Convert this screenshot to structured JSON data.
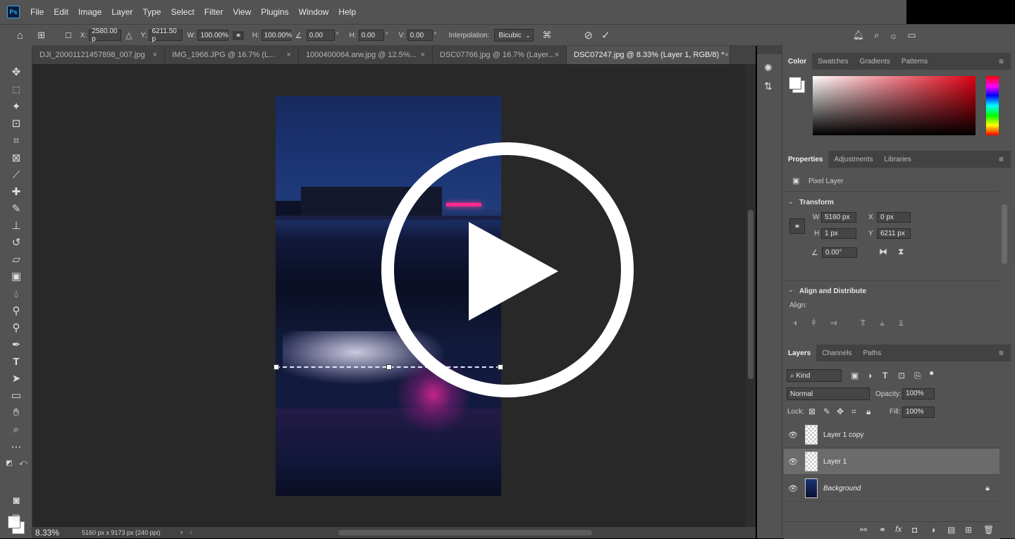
{
  "app": {
    "logo_text": "Ps"
  },
  "menu": [
    "File",
    "Edit",
    "Image",
    "Layer",
    "Type",
    "Select",
    "Filter",
    "View",
    "Plugins",
    "Window",
    "Help"
  ],
  "options": {
    "x_label": "X:",
    "x_value": "2580.00 p",
    "y_label": "Y:",
    "y_value": "6211.50 p",
    "w_label": "W:",
    "w_value": "100.00%",
    "h_label": "H:",
    "h_value": "100.00%",
    "angle_value": "0.00",
    "deg": "°",
    "hskew_label": "H:",
    "hskew_value": "0.00",
    "vskew_label": "V:",
    "vskew_value": "0.00",
    "interp_label": "Interpolation:",
    "interp_value": "Bicubic"
  },
  "tabs": [
    {
      "label": "DJI_20001121457898_007.jpg",
      "close": "×"
    },
    {
      "label": "IMG_1968.JPG @ 16.7% (L...",
      "close": "×"
    },
    {
      "label": "1000400064.arw.jpg @ 12.5%...",
      "close": "×"
    },
    {
      "label": "DSC07766.jpg @ 16.7% (Layer...",
      "close": "×"
    },
    {
      "label": "DSC07247.jpg @ 8.33% (Layer 1, RGB/8) *",
      "close": "×"
    }
  ],
  "status": {
    "zoom": "8.33%",
    "doc_size": "5160 px x 9173 px (240 ppi)",
    "arrow": "›",
    "left_arrow": "‹"
  },
  "color_panel": {
    "tabs": [
      "Color",
      "Swatches",
      "Gradients",
      "Patterns"
    ],
    "menu": "≡"
  },
  "properties_panel": {
    "tabs": [
      "Properties",
      "Adjustments",
      "Libraries"
    ],
    "layer_type": "Pixel Layer",
    "transform_title": "Transform",
    "w_label": "W",
    "w_value": "5160 px",
    "x_label": "X",
    "x_value": "0 px",
    "h_label": "H",
    "h_value": "1 px",
    "y_label": "Y",
    "y_value": "6211 px",
    "angle_value": "0.00°",
    "align_title": "Align and Distribute",
    "align_label": "Align:"
  },
  "layers_panel": {
    "tabs": [
      "Layers",
      "Channels",
      "Paths"
    ],
    "kind_label": "Kind",
    "blend_mode": "Normal",
    "opacity_label": "Opacity:",
    "opacity_value": "100%",
    "lock_label": "Lock:",
    "fill_label": "Fill:",
    "fill_value": "100%",
    "layers": [
      {
        "name": "Layer 1 copy"
      },
      {
        "name": "Layer 1"
      },
      {
        "name": "Background"
      }
    ]
  },
  "colors": {
    "accent": "#31a8ff",
    "panel": "#535353",
    "canvas_bg": "#282828",
    "neon": "#ff2a8c"
  }
}
